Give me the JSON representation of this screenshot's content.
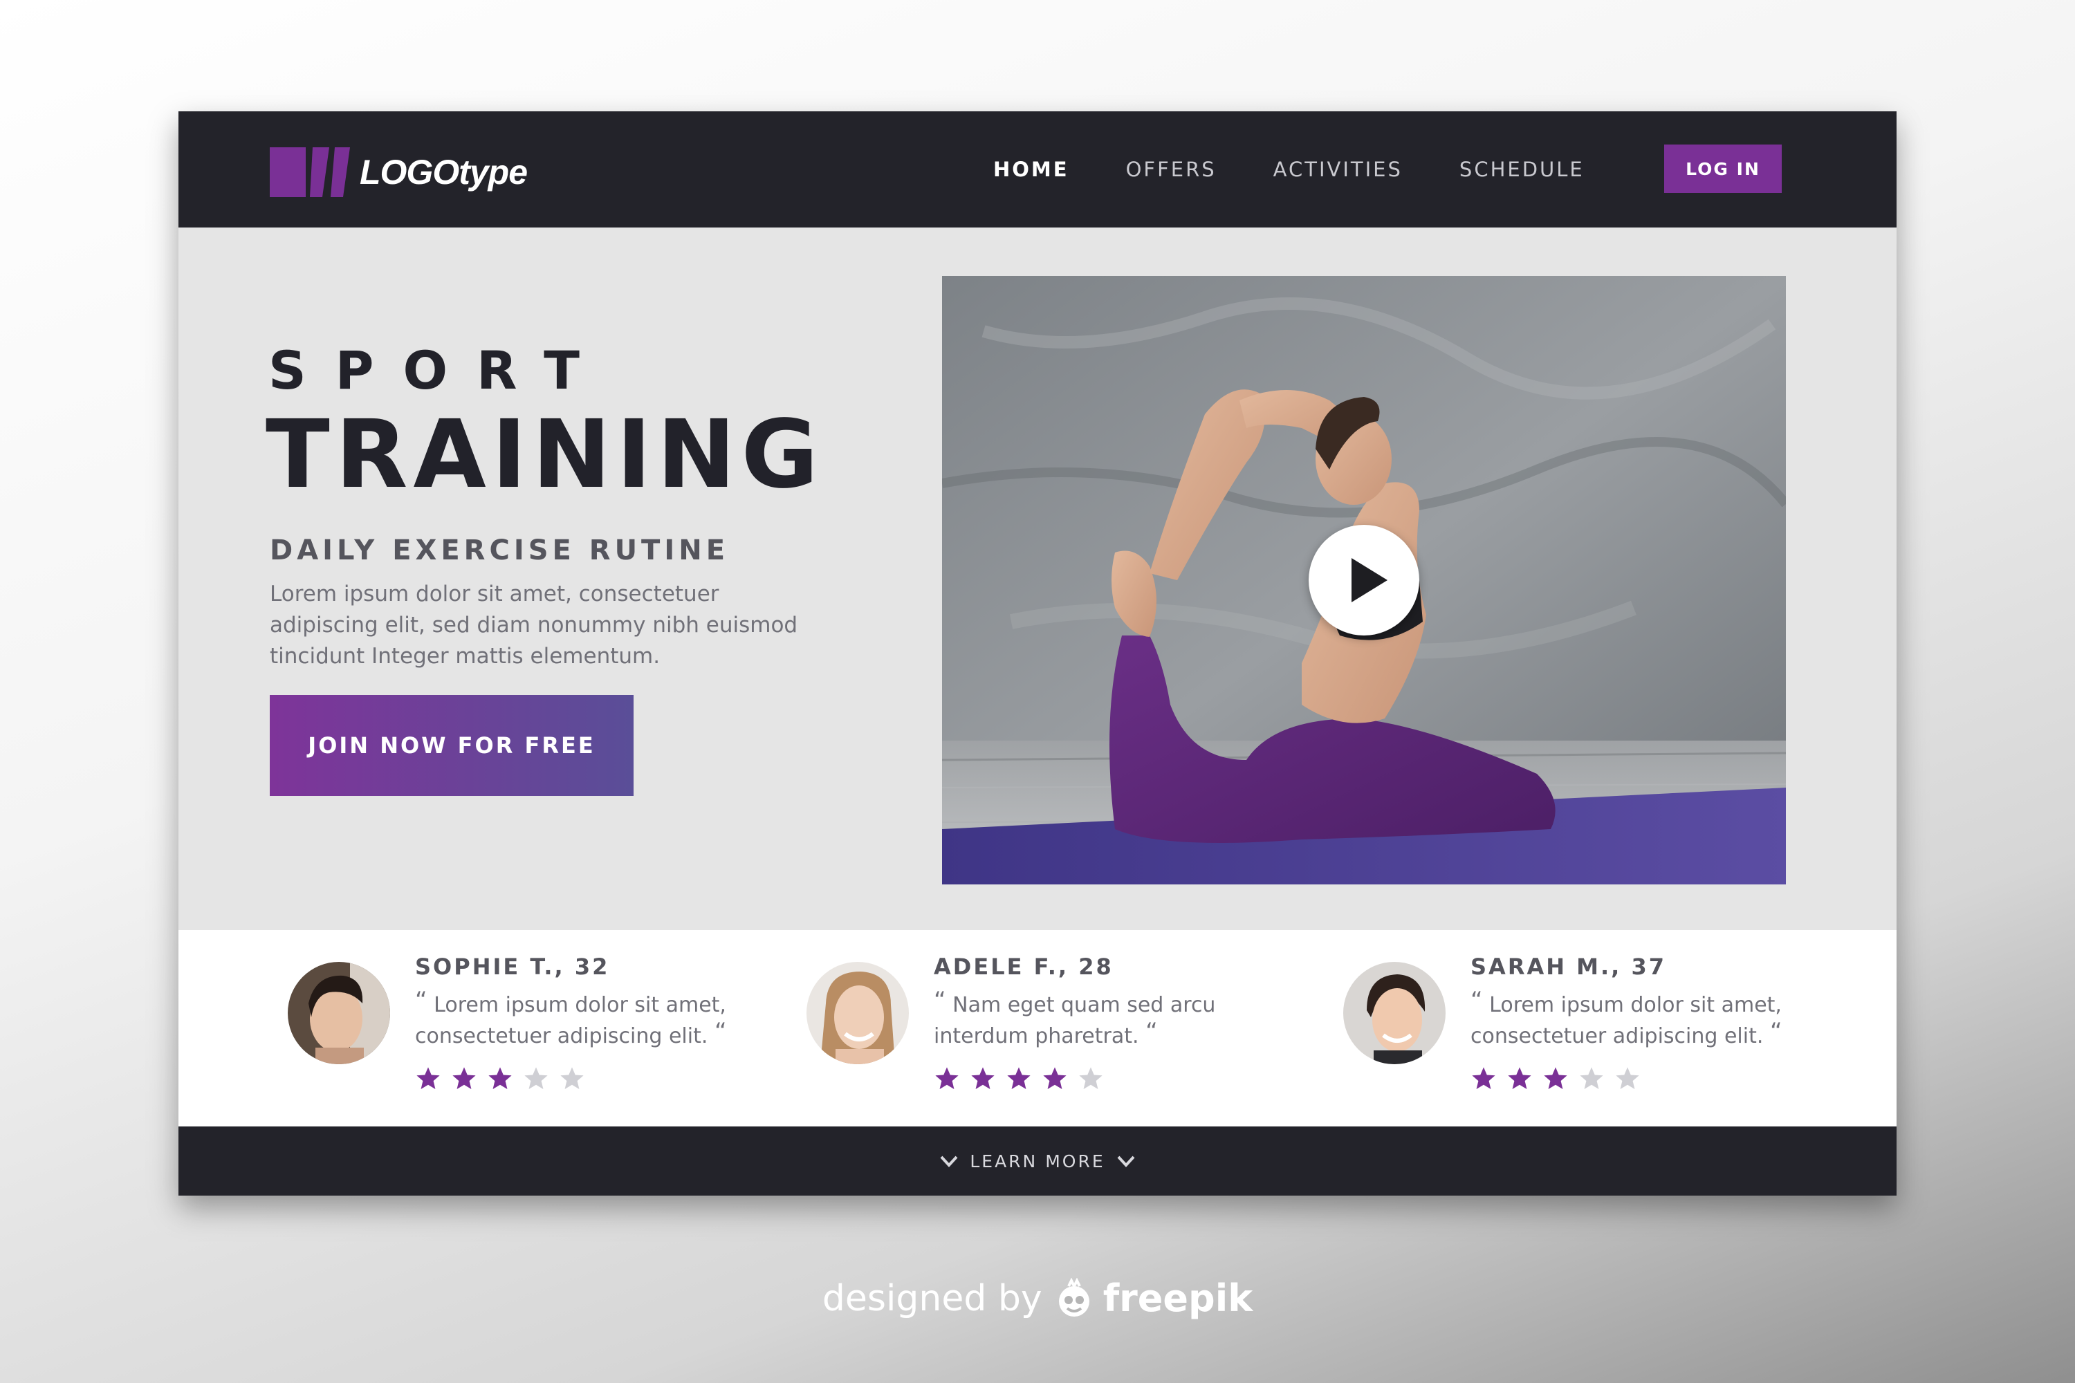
{
  "brand": {
    "logo_text": "LOGOtype",
    "accent": "#7a3096",
    "dark": "#23232a"
  },
  "nav": {
    "items": [
      {
        "label": "HOME",
        "active": true
      },
      {
        "label": "OFFERS",
        "active": false
      },
      {
        "label": "ACTIVITIES",
        "active": false
      },
      {
        "label": "SCHEDULE",
        "active": false
      }
    ],
    "login_label": "LOG IN"
  },
  "hero": {
    "kicker": "SPORT",
    "title": "TRAINING",
    "subtitle": "DAILY EXERCISE RUTINE",
    "text": "Lorem ipsum dolor sit amet, consectetuer adipiscing elit, sed diam nonummy nibh euismod tincidunt Integer mattis elementum.",
    "cta_label": "JOIN NOW FOR FREE"
  },
  "video": {
    "play_icon": "play-icon"
  },
  "testimonials": [
    {
      "name": "SOPHIE T., 32",
      "quote": "Lorem ipsum dolor sit amet, consectetuer adipiscing elit.",
      "rating": 3,
      "max": 5
    },
    {
      "name": "ADELE F., 28",
      "quote": "Nam eget quam sed arcu interdum pharetrat.",
      "rating": 4,
      "max": 5
    },
    {
      "name": "SARAH M., 37",
      "quote": "Lorem ipsum dolor sit amet, consectetuer adipiscing elit.",
      "rating": 3,
      "max": 5
    }
  ],
  "quote_open": "“",
  "quote_close": "“",
  "footer": {
    "learn_more_label": "LEARN MORE"
  },
  "credit": {
    "text": "designed by",
    "brand": "freepik"
  },
  "colors": {
    "star_on": "#7a3096",
    "star_off": "#cfcfd4"
  }
}
